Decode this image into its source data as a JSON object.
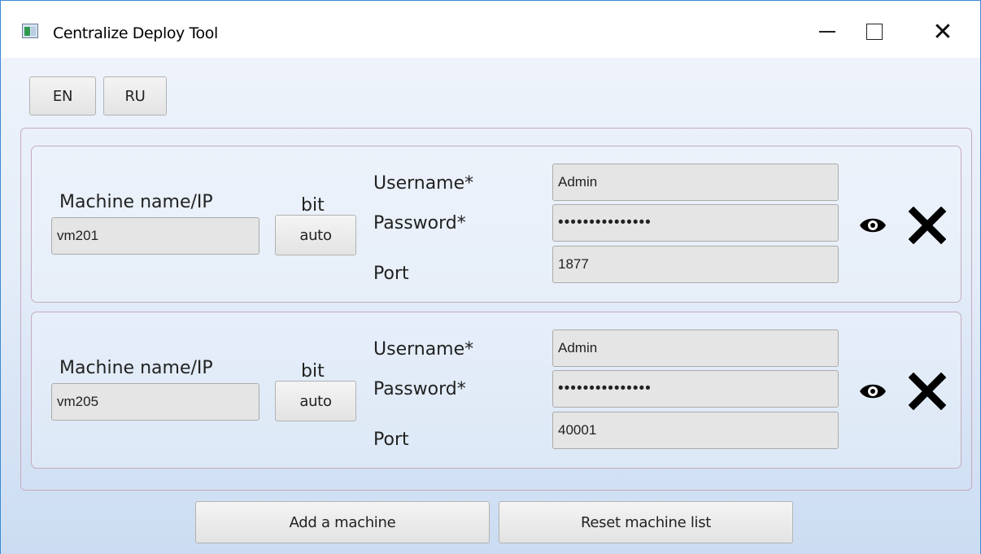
{
  "window": {
    "title": "Centralize Deploy Tool",
    "controls": [
      "minimize",
      "maximize",
      "close"
    ],
    "close_glyph": "✕"
  },
  "language": {
    "en_label": "EN",
    "ru_label": "RU"
  },
  "labels": {
    "machine": "Machine name/IP",
    "bit": "bit",
    "username": "Username*",
    "password": "Password*",
    "port": "Port"
  },
  "machines": [
    {
      "name": "vm201",
      "bit": "auto",
      "username": "Admin",
      "password_mask": "•••••••••••••••",
      "port": "1877"
    },
    {
      "name": "vm205",
      "bit": "auto",
      "username": "Admin",
      "password_mask": "•••••••••••••••",
      "port": "40001"
    }
  ],
  "icons": {
    "show_password": "eye-icon",
    "remove_machine": "x-icon"
  },
  "actions": {
    "add_label": "Add a machine",
    "reset_label": "Reset machine list"
  }
}
